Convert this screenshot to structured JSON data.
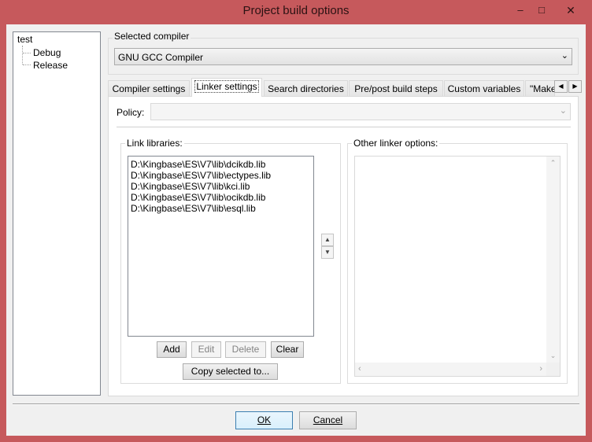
{
  "window": {
    "title": "Project build options",
    "minimize_glyph": "–",
    "maximize_glyph": "□",
    "close_glyph": "✕"
  },
  "tree": {
    "root": "test",
    "children": [
      "Debug",
      "Release"
    ]
  },
  "compiler": {
    "label": "Selected compiler",
    "value": "GNU GCC Compiler"
  },
  "tabs": [
    {
      "label": "Compiler settings",
      "active": false
    },
    {
      "label": "Linker settings",
      "active": true
    },
    {
      "label": "Search directories",
      "active": false
    },
    {
      "label": "Pre/post build steps",
      "active": false
    },
    {
      "label": "Custom variables",
      "active": false
    },
    {
      "label": "\"Make",
      "active": false
    }
  ],
  "linker": {
    "policy_label": "Policy:",
    "policy_value": "",
    "link_libraries_label": "Link libraries:",
    "libraries": [
      "D:\\Kingbase\\ES\\V7\\lib\\dcikdb.lib",
      "D:\\Kingbase\\ES\\V7\\lib\\ectypes.lib",
      "D:\\Kingbase\\ES\\V7\\lib\\kci.lib",
      "D:\\Kingbase\\ES\\V7\\lib\\ocikdb.lib",
      "D:\\Kingbase\\ES\\V7\\lib\\esql.lib"
    ],
    "add_label": "Add",
    "edit_label": "Edit",
    "delete_label": "Delete",
    "clear_label": "Clear",
    "copy_label": "Copy selected to...",
    "other_options_label": "Other linker options:",
    "other_options_value": ""
  },
  "footer": {
    "ok_label": "OK",
    "cancel_label": "Cancel"
  },
  "colors": {
    "titlebar": "#c6595c",
    "dialog_bg": "#f0f0f0"
  }
}
